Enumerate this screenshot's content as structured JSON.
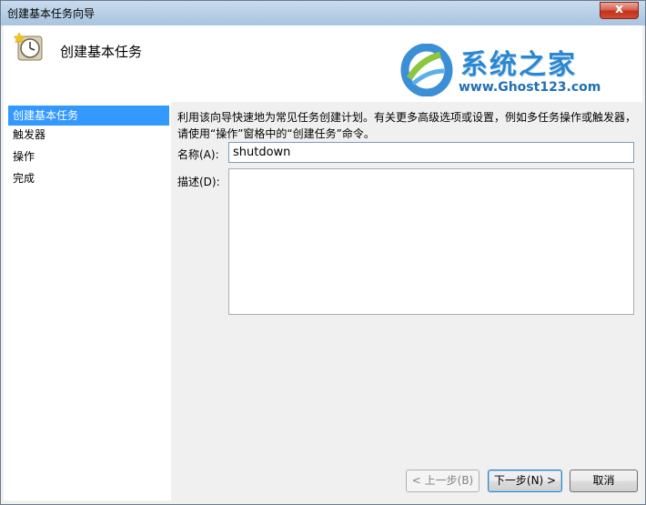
{
  "window": {
    "title": "创建基本任务向导",
    "close_glyph": "x"
  },
  "header": {
    "icon": "scheduled-task-clock-icon",
    "title": "创建基本任务"
  },
  "watermark": {
    "main": "系统之家",
    "url": "www.Ghost123.com"
  },
  "nav": {
    "items": [
      {
        "label": "创建基本任务",
        "active": true
      },
      {
        "label": "触发器",
        "active": false
      },
      {
        "label": "操作",
        "active": false
      },
      {
        "label": "完成",
        "active": false
      }
    ]
  },
  "content": {
    "description": "利用该向导快速地为常见任务创建计划。有关更多高级选项或设置，例如多任务操作或触发器，请使用“操作”窗格中的“创建任务”命令。",
    "name_label": "名称(A):",
    "name_value": "shutdown",
    "desc_label": "描述(D):",
    "desc_value": ""
  },
  "buttons": {
    "back": "< 上一步(B)",
    "next": "下一步(N) >",
    "cancel": "取消"
  },
  "colors": {
    "selection": "#3399ff",
    "logo_blue": "#2e86d0"
  }
}
